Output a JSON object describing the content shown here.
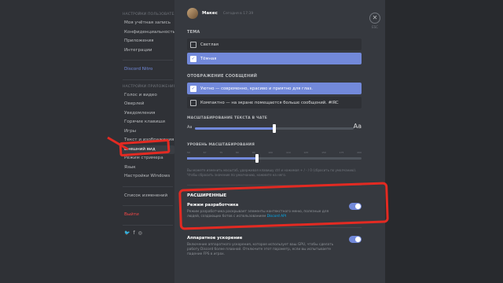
{
  "sidebar": {
    "user_settings_header": "НАСТРОЙКИ ПОЛЬЗОВАТЕЛЯ",
    "user_items": [
      {
        "label": "Моя учётная запись"
      },
      {
        "label": "Конфиденциальность"
      },
      {
        "label": "Приложения"
      },
      {
        "label": "Интеграции"
      }
    ],
    "nitro_label": "Discord Nitro",
    "app_settings_header": "НАСТРОЙКИ ПРИЛОЖЕНИЯ",
    "app_items": [
      {
        "label": "Голос и видео"
      },
      {
        "label": "Оверлей"
      },
      {
        "label": "Уведомления"
      },
      {
        "label": "Горячие клавиши"
      },
      {
        "label": "Игры"
      },
      {
        "label": "Текст и изображения"
      },
      {
        "label": "Внешний вид",
        "selected": true
      },
      {
        "label": "Режим стримера"
      },
      {
        "label": "Язык"
      },
      {
        "label": "Настройки Windows"
      }
    ],
    "changelog_label": "Список изменений",
    "logout_label": "Выйти",
    "social": {
      "twitter": "🐦",
      "facebook": "f",
      "instagram": "◎"
    }
  },
  "preview": {
    "username": "Макес",
    "date": "Сегодня в 17:39"
  },
  "theme": {
    "title": "ТЕМА",
    "options": [
      {
        "label": "Светлая",
        "selected": false
      },
      {
        "label": "Тёмная",
        "selected": true
      }
    ]
  },
  "message_display": {
    "title": "ОТОБРАЖЕНИЕ СООБЩЕНИЙ",
    "options": [
      {
        "label": "Уютно — современно, красиво и приятно для глаз.",
        "selected": true
      },
      {
        "label": "Компактно — на экране помещается больше сообщений. #IRC",
        "selected": false
      }
    ]
  },
  "chat_font_scaling": {
    "label": "МАСШТАБИРОВАНИЕ ТЕКСТА В ЧАТЕ",
    "small": "Aa",
    "big": "Aa",
    "value_fraction": 0.5
  },
  "zoom_level": {
    "label": "УРОВЕНЬ МАСШТАБИРОВАНИЯ",
    "ticks": [
      "50",
      "67",
      "75",
      "80",
      "90",
      "100",
      "110",
      "125",
      "150",
      "175",
      "200"
    ],
    "value": "100",
    "value_fraction": 0.4,
    "help": "Вы можете изменить масштаб, удерживая клавишу ctrl и нажимая + / - / 0 (сбросить по умолчанию). Чтобы сбросить значение по умолчанию, нажмите на него."
  },
  "advanced": {
    "title": "РАСШИРЕННЫЕ",
    "dev_mode": {
      "label": "Режим разработчика",
      "desc": "Режим разработчика раскрывает элементы контекстного меню, полезные для людей, создающих ботов с использованием",
      "link": "Discord API",
      "enabled": true
    },
    "hw_accel": {
      "label": "Аппаратное ускорение",
      "desc": "Включение аппаратного ускорения, которое использует ваш GPU, чтобы сделать работу Discord более плавной. Отключите этот параметр, если вы испытываете падение FPS в играх.",
      "enabled": true
    }
  },
  "close": {
    "icon": "✕",
    "label": "ESC"
  },
  "colors": {
    "accent": "#7289da",
    "annotation": "#e32a22",
    "toggle_on": "#7289da"
  }
}
